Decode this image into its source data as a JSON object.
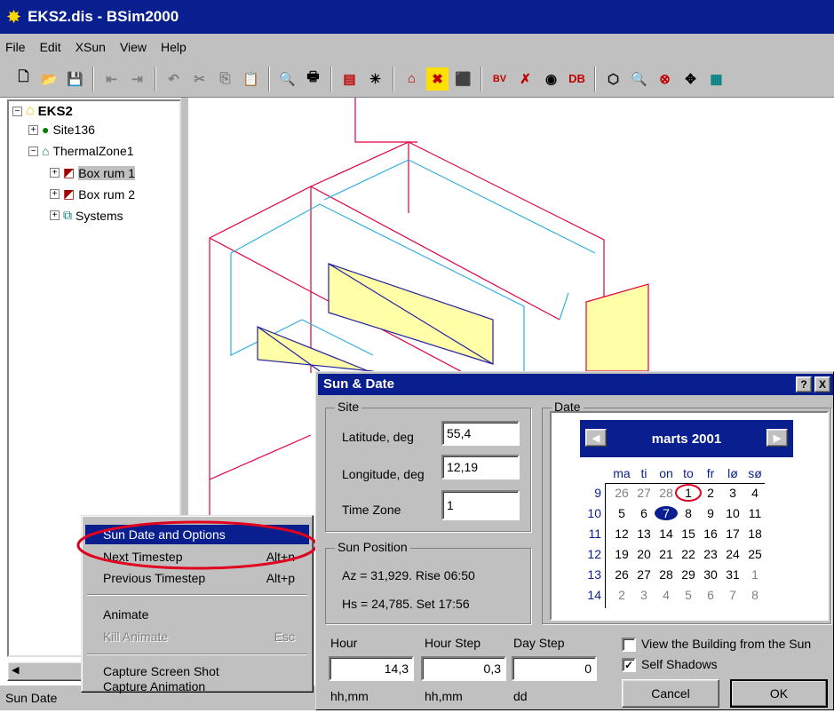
{
  "window": {
    "title": "EKS2.dis - BSim2000"
  },
  "menu": [
    "File",
    "Edit",
    "XSun",
    "View",
    "Help"
  ],
  "toolbar_icons": [
    "new-file",
    "open-folder",
    "save",
    "indent",
    "outdent",
    "undo",
    "cut",
    "copy",
    "paste",
    "print-preview",
    "print",
    "calc",
    "sun",
    "house",
    "x-tool",
    "building-3d",
    "bv",
    "cross",
    "book",
    "db",
    "shape",
    "zoom",
    "zoom-out",
    "move",
    "grid"
  ],
  "toolbar_labels": {
    "bv": "BV",
    "db": "DB"
  },
  "tree": [
    {
      "label": "EKS2",
      "level": 0
    },
    {
      "label": "Site136",
      "level": 1
    },
    {
      "label": "ThermalZone1",
      "level": 1
    },
    {
      "label": "Box rum 1",
      "level": 2
    },
    {
      "label": "Box rum 2",
      "level": 2
    },
    {
      "label": "Systems",
      "level": 2
    }
  ],
  "statusbar": {
    "text": "Sun Date"
  },
  "context_menu": [
    {
      "label": "Sun Date and Options",
      "shortcut": ""
    },
    {
      "label": "Next Timestep",
      "shortcut": "Alt+n"
    },
    {
      "label": "Previous Timestep",
      "shortcut": "Alt+p"
    },
    {
      "label": "Animate",
      "shortcut": ""
    },
    {
      "label": "Kill Animate",
      "shortcut": "Esc"
    },
    {
      "label": "Capture Screen Shot",
      "shortcut": ""
    },
    {
      "label": "Capture Animation",
      "shortcut": ""
    }
  ],
  "dialog": {
    "title": "Sun & Date",
    "help_btn": "?",
    "close_btn": "X",
    "site": {
      "group": "Site",
      "latitude_label": "Latitude, deg",
      "latitude_value": "55,4",
      "longitude_label": "Longitude, deg",
      "longitude_value": "12,19",
      "timezone_label": "Time Zone",
      "timezone_value": "1"
    },
    "sun_position": {
      "group": "Sun Position",
      "line1": "Az = 31,929. Rise 06:50",
      "line2": "Hs = 24,785. Set 17:56"
    },
    "date": {
      "group": "Date",
      "month_label": "marts 2001",
      "weekdays": [
        "ma",
        "ti",
        "on",
        "to",
        "fr",
        "lø",
        "sø"
      ],
      "weeks": [
        9,
        10,
        11,
        12,
        13,
        14
      ],
      "days": [
        [
          "26",
          "27",
          "28",
          "1",
          "2",
          "3",
          "4"
        ],
        [
          "5",
          "6",
          "7",
          "8",
          "9",
          "10",
          "11"
        ],
        [
          "12",
          "13",
          "14",
          "15",
          "16",
          "17",
          "18"
        ],
        [
          "19",
          "20",
          "21",
          "22",
          "23",
          "24",
          "25"
        ],
        [
          "26",
          "27",
          "28",
          "29",
          "30",
          "31",
          "1"
        ],
        [
          "2",
          "3",
          "4",
          "5",
          "6",
          "7",
          "8"
        ]
      ]
    },
    "hour": {
      "label": "Hour",
      "value": "14,3",
      "unit": "hh,mm"
    },
    "hour_step": {
      "label": "Hour Step",
      "value": "0,3",
      "unit": "hh,mm"
    },
    "day_step": {
      "label": "Day Step",
      "value": "0",
      "unit": "dd"
    },
    "view_from_sun": {
      "label": "View the Building from the Sun",
      "checked": false
    },
    "self_shadows": {
      "label": "Self Shadows",
      "checked": true
    },
    "cancel": "Cancel",
    "ok": "OK"
  }
}
